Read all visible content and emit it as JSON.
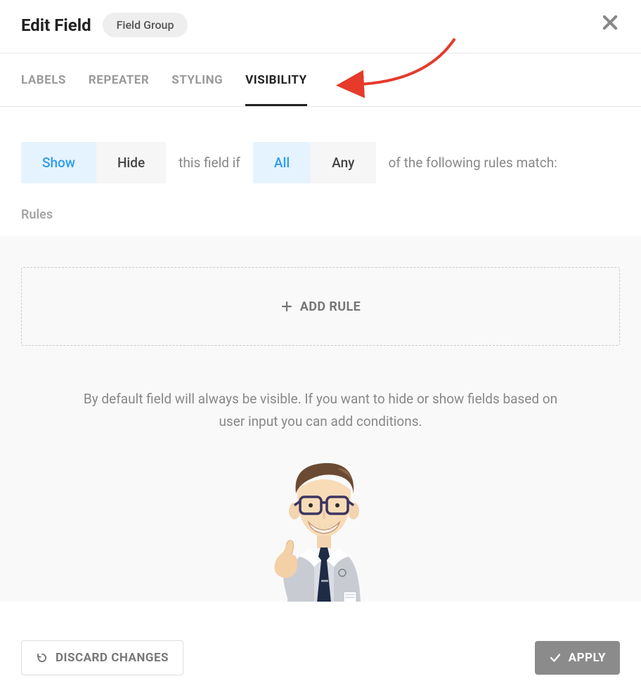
{
  "header": {
    "title": "Edit Field",
    "pill": "Field Group"
  },
  "tabs": [
    {
      "label": "LABELS",
      "active": false
    },
    {
      "label": "REPEATER",
      "active": false
    },
    {
      "label": "STYLING",
      "active": false
    },
    {
      "label": "VISIBILITY",
      "active": true
    }
  ],
  "visibility": {
    "showhide": {
      "show": "Show",
      "hide": "Hide",
      "selected": "show"
    },
    "text1": "this field if",
    "allany": {
      "all": "All",
      "any": "Any",
      "selected": "all"
    },
    "text2": "of the following rules match:",
    "rules_label": "Rules",
    "add_rule": "ADD RULE",
    "help_text": "By default field will always be visible. If you want to hide or show fields based on user input you can add conditions."
  },
  "footer": {
    "discard": "DISCARD CHANGES",
    "apply": "APPLY"
  }
}
